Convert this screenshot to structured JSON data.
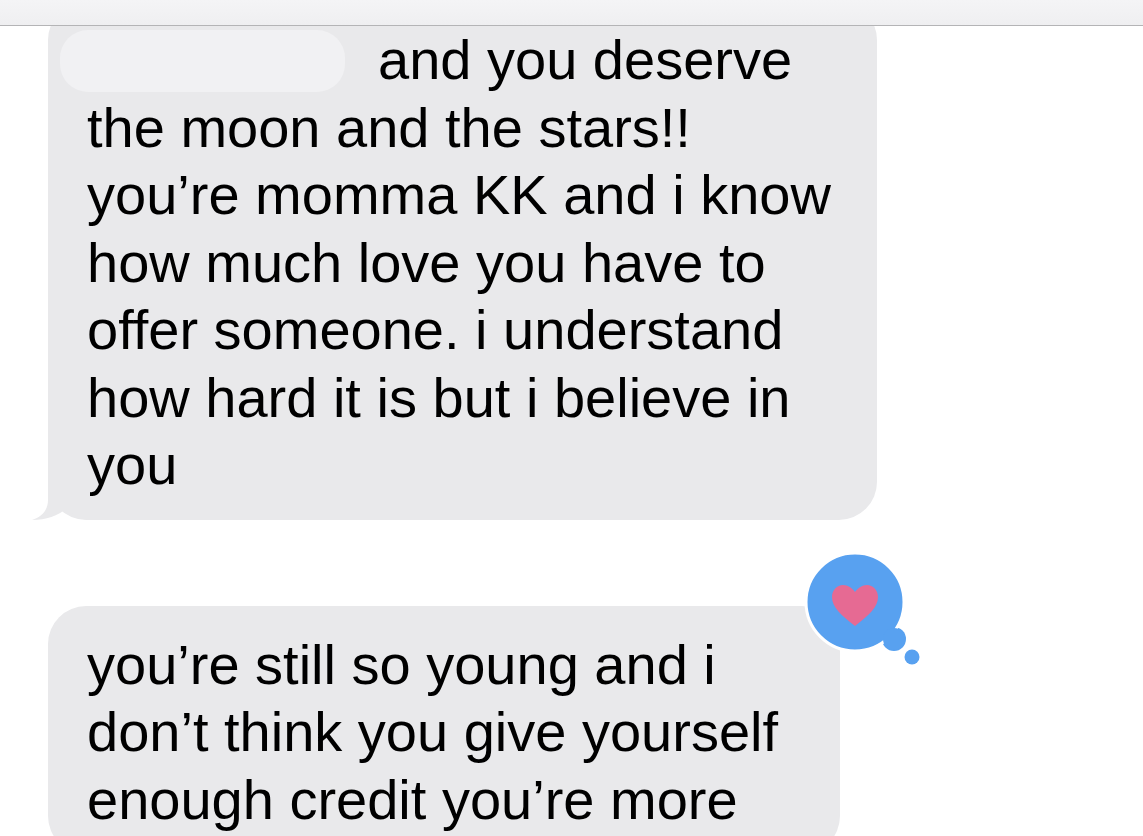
{
  "messages": [
    {
      "text": "and you deserve\nthe moon and the stars!!\nyou’re momma KK and i know\nhow much love you have to\noffer someone. i understand\nhow hard it is but i believe in\nyou",
      "redacted": true,
      "tail": true,
      "reacted": false
    },
    {
      "text": "you’re still so young and i\ndon’t think you give yourself\nenough credit you’re more",
      "redacted": false,
      "tail": false,
      "reacted": true
    }
  ]
}
